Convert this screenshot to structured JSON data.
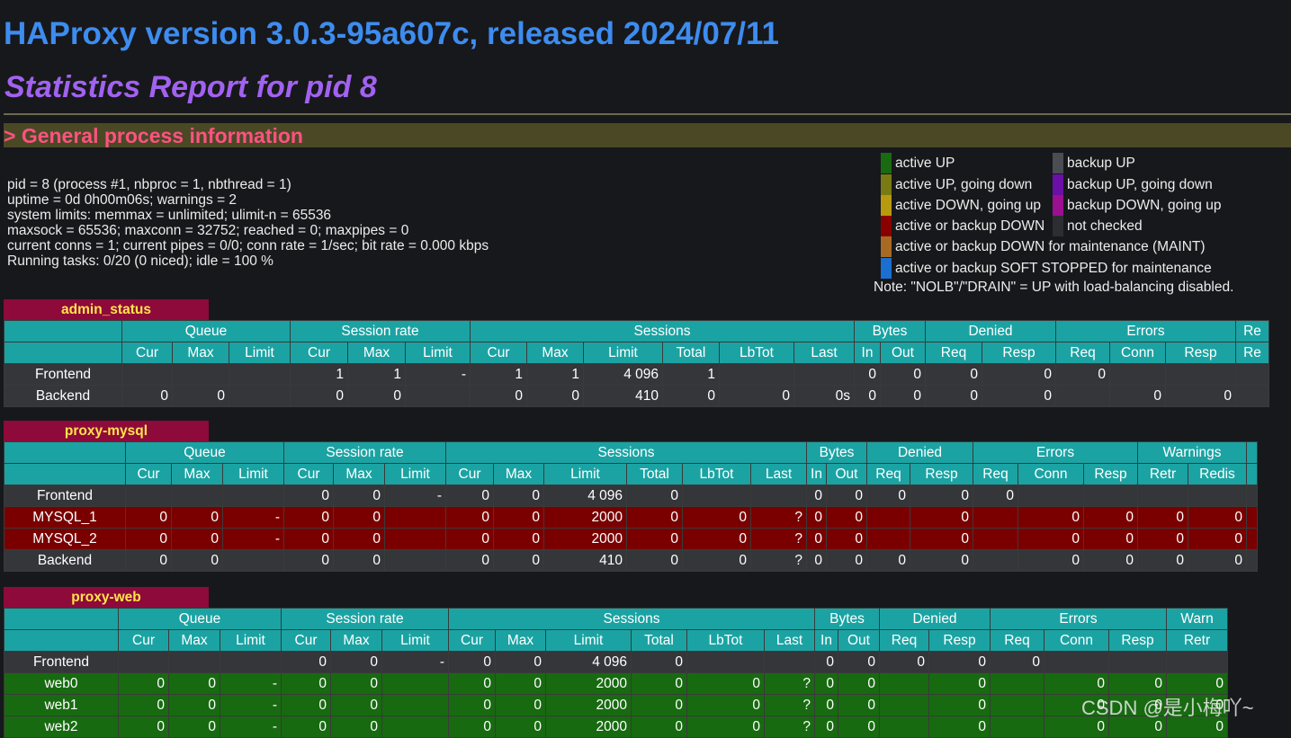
{
  "header": {
    "title": "HAProxy version 3.0.3-95a607c, released 2024/07/11",
    "subtitle": "Statistics Report for pid 8",
    "section": "> General process information"
  },
  "info": {
    "line1": "pid = 8 (process #1, nbproc = 1, nbthread = 1)",
    "line2": "uptime = 0d 0h00m06s; warnings = 2",
    "line3": "system limits: memmax = unlimited; ulimit-n = 65536",
    "line4": "maxsock = 65536; maxconn = 32752; reached = 0; maxpipes = 0",
    "line5": "current conns = 1; current pipes = 0/0; conn rate = 1/sec; bit rate = 0.000 kbps",
    "line6": "Running tasks: 0/20 (0 niced); idle = 100 %"
  },
  "legend": {
    "items": [
      {
        "label": "active UP",
        "color": "#1a6a12"
      },
      {
        "label": "active UP, going down",
        "color": "#7a7a14"
      },
      {
        "label": "active DOWN, going up",
        "color": "#b89a10"
      },
      {
        "label": "active or backup DOWN",
        "color": "#8a0000"
      },
      {
        "label": "active or backup DOWN for maintenance (MAINT)",
        "color": "#a86a22"
      },
      {
        "label": "active or backup SOFT STOPPED for maintenance",
        "color": "#1a6fd0"
      },
      {
        "label": "backup UP",
        "color": "#4a4d52"
      },
      {
        "label": "backup UP, going down",
        "color": "#6a10a8"
      },
      {
        "label": "backup DOWN, going up",
        "color": "#9a1090"
      },
      {
        "label": "not checked",
        "color": "#2c2e32"
      }
    ],
    "note": "Note: \"NOLB\"/\"DRAIN\" = UP with load-balancing disabled."
  },
  "proxies": {
    "admin_status": {
      "name": "admin_status",
      "groups": [
        "",
        "Queue",
        "Session rate",
        "Sessions",
        "Bytes",
        "Denied",
        "Errors",
        "Re"
      ],
      "cols": [
        "",
        "Cur",
        "Max",
        "Limit",
        "Cur",
        "Max",
        "Limit",
        "Cur",
        "Max",
        "Limit",
        "Total",
        "LbTot",
        "Last",
        "In",
        "Out",
        "Req",
        "Resp",
        "Req",
        "Conn",
        "Resp",
        "Re"
      ],
      "rows": [
        {
          "type": "fe",
          "cells": [
            "Frontend",
            "",
            "",
            "",
            "1",
            "1",
            "-",
            "1",
            "1",
            "4 096",
            "1",
            "",
            "",
            "0",
            "0",
            "0",
            "0",
            "0",
            "",
            "",
            ""
          ]
        },
        {
          "type": "be",
          "cells": [
            "Backend",
            "0",
            "0",
            "",
            "0",
            "0",
            "",
            "0",
            "0",
            "410",
            "0",
            "0",
            "0s",
            "0",
            "0",
            "0",
            "0",
            "",
            "0",
            "0",
            ""
          ]
        }
      ]
    },
    "proxy_mysql": {
      "name": "proxy-mysql",
      "groups": [
        "",
        "Queue",
        "Session rate",
        "Sessions",
        "Bytes",
        "Denied",
        "Errors",
        "Warnings",
        ""
      ],
      "cols": [
        "",
        "Cur",
        "Max",
        "Limit",
        "Cur",
        "Max",
        "Limit",
        "Cur",
        "Max",
        "Limit",
        "Total",
        "LbTot",
        "Last",
        "In",
        "Out",
        "Req",
        "Resp",
        "Req",
        "Conn",
        "Resp",
        "Retr",
        "Redis",
        ""
      ],
      "rows": [
        {
          "type": "fe",
          "cells": [
            "Frontend",
            "",
            "",
            "",
            "0",
            "0",
            "-",
            "0",
            "0",
            "4 096",
            "0",
            "",
            "",
            "0",
            "0",
            "0",
            "0",
            "0",
            "",
            "",
            "",
            "",
            ""
          ]
        },
        {
          "type": "down",
          "cells": [
            "MYSQL_1",
            "0",
            "0",
            "-",
            "0",
            "0",
            "",
            "0",
            "0",
            "2000",
            "0",
            "0",
            "?",
            "0",
            "0",
            "",
            "0",
            "",
            "0",
            "0",
            "0",
            "0",
            ""
          ]
        },
        {
          "type": "down",
          "cells": [
            "MYSQL_2",
            "0",
            "0",
            "-",
            "0",
            "0",
            "",
            "0",
            "0",
            "2000",
            "0",
            "0",
            "?",
            "0",
            "0",
            "",
            "0",
            "",
            "0",
            "0",
            "0",
            "0",
            ""
          ]
        },
        {
          "type": "be",
          "cells": [
            "Backend",
            "0",
            "0",
            "",
            "0",
            "0",
            "",
            "0",
            "0",
            "410",
            "0",
            "0",
            "?",
            "0",
            "0",
            "0",
            "0",
            "",
            "0",
            "0",
            "0",
            "0",
            ""
          ]
        }
      ]
    },
    "proxy_web": {
      "name": "proxy-web",
      "groups": [
        "",
        "Queue",
        "Session rate",
        "Sessions",
        "Bytes",
        "Denied",
        "Errors",
        "Warn"
      ],
      "cols": [
        "",
        "Cur",
        "Max",
        "Limit",
        "Cur",
        "Max",
        "Limit",
        "Cur",
        "Max",
        "Limit",
        "Total",
        "LbTot",
        "Last",
        "In",
        "Out",
        "Req",
        "Resp",
        "Req",
        "Conn",
        "Resp",
        "Retr"
      ],
      "rows": [
        {
          "type": "fe",
          "cells": [
            "Frontend",
            "",
            "",
            "",
            "0",
            "0",
            "-",
            "0",
            "0",
            "4 096",
            "0",
            "",
            "",
            "0",
            "0",
            "0",
            "0",
            "0",
            "",
            "",
            ""
          ]
        },
        {
          "type": "up",
          "cells": [
            "web0",
            "0",
            "0",
            "-",
            "0",
            "0",
            "",
            "0",
            "0",
            "2000",
            "0",
            "0",
            "?",
            "0",
            "0",
            "",
            "0",
            "",
            "0",
            "0",
            "0"
          ]
        },
        {
          "type": "up",
          "cells": [
            "web1",
            "0",
            "0",
            "-",
            "0",
            "0",
            "",
            "0",
            "0",
            "2000",
            "0",
            "0",
            "?",
            "0",
            "0",
            "",
            "0",
            "",
            "0",
            "0",
            "0"
          ]
        },
        {
          "type": "up",
          "cells": [
            "web2",
            "0",
            "0",
            "-",
            "0",
            "0",
            "",
            "0",
            "0",
            "2000",
            "0",
            "0",
            "?",
            "0",
            "0",
            "",
            "0",
            "",
            "0",
            "0",
            "0"
          ]
        }
      ]
    }
  },
  "watermark": "CSDN @是小梅吖~"
}
